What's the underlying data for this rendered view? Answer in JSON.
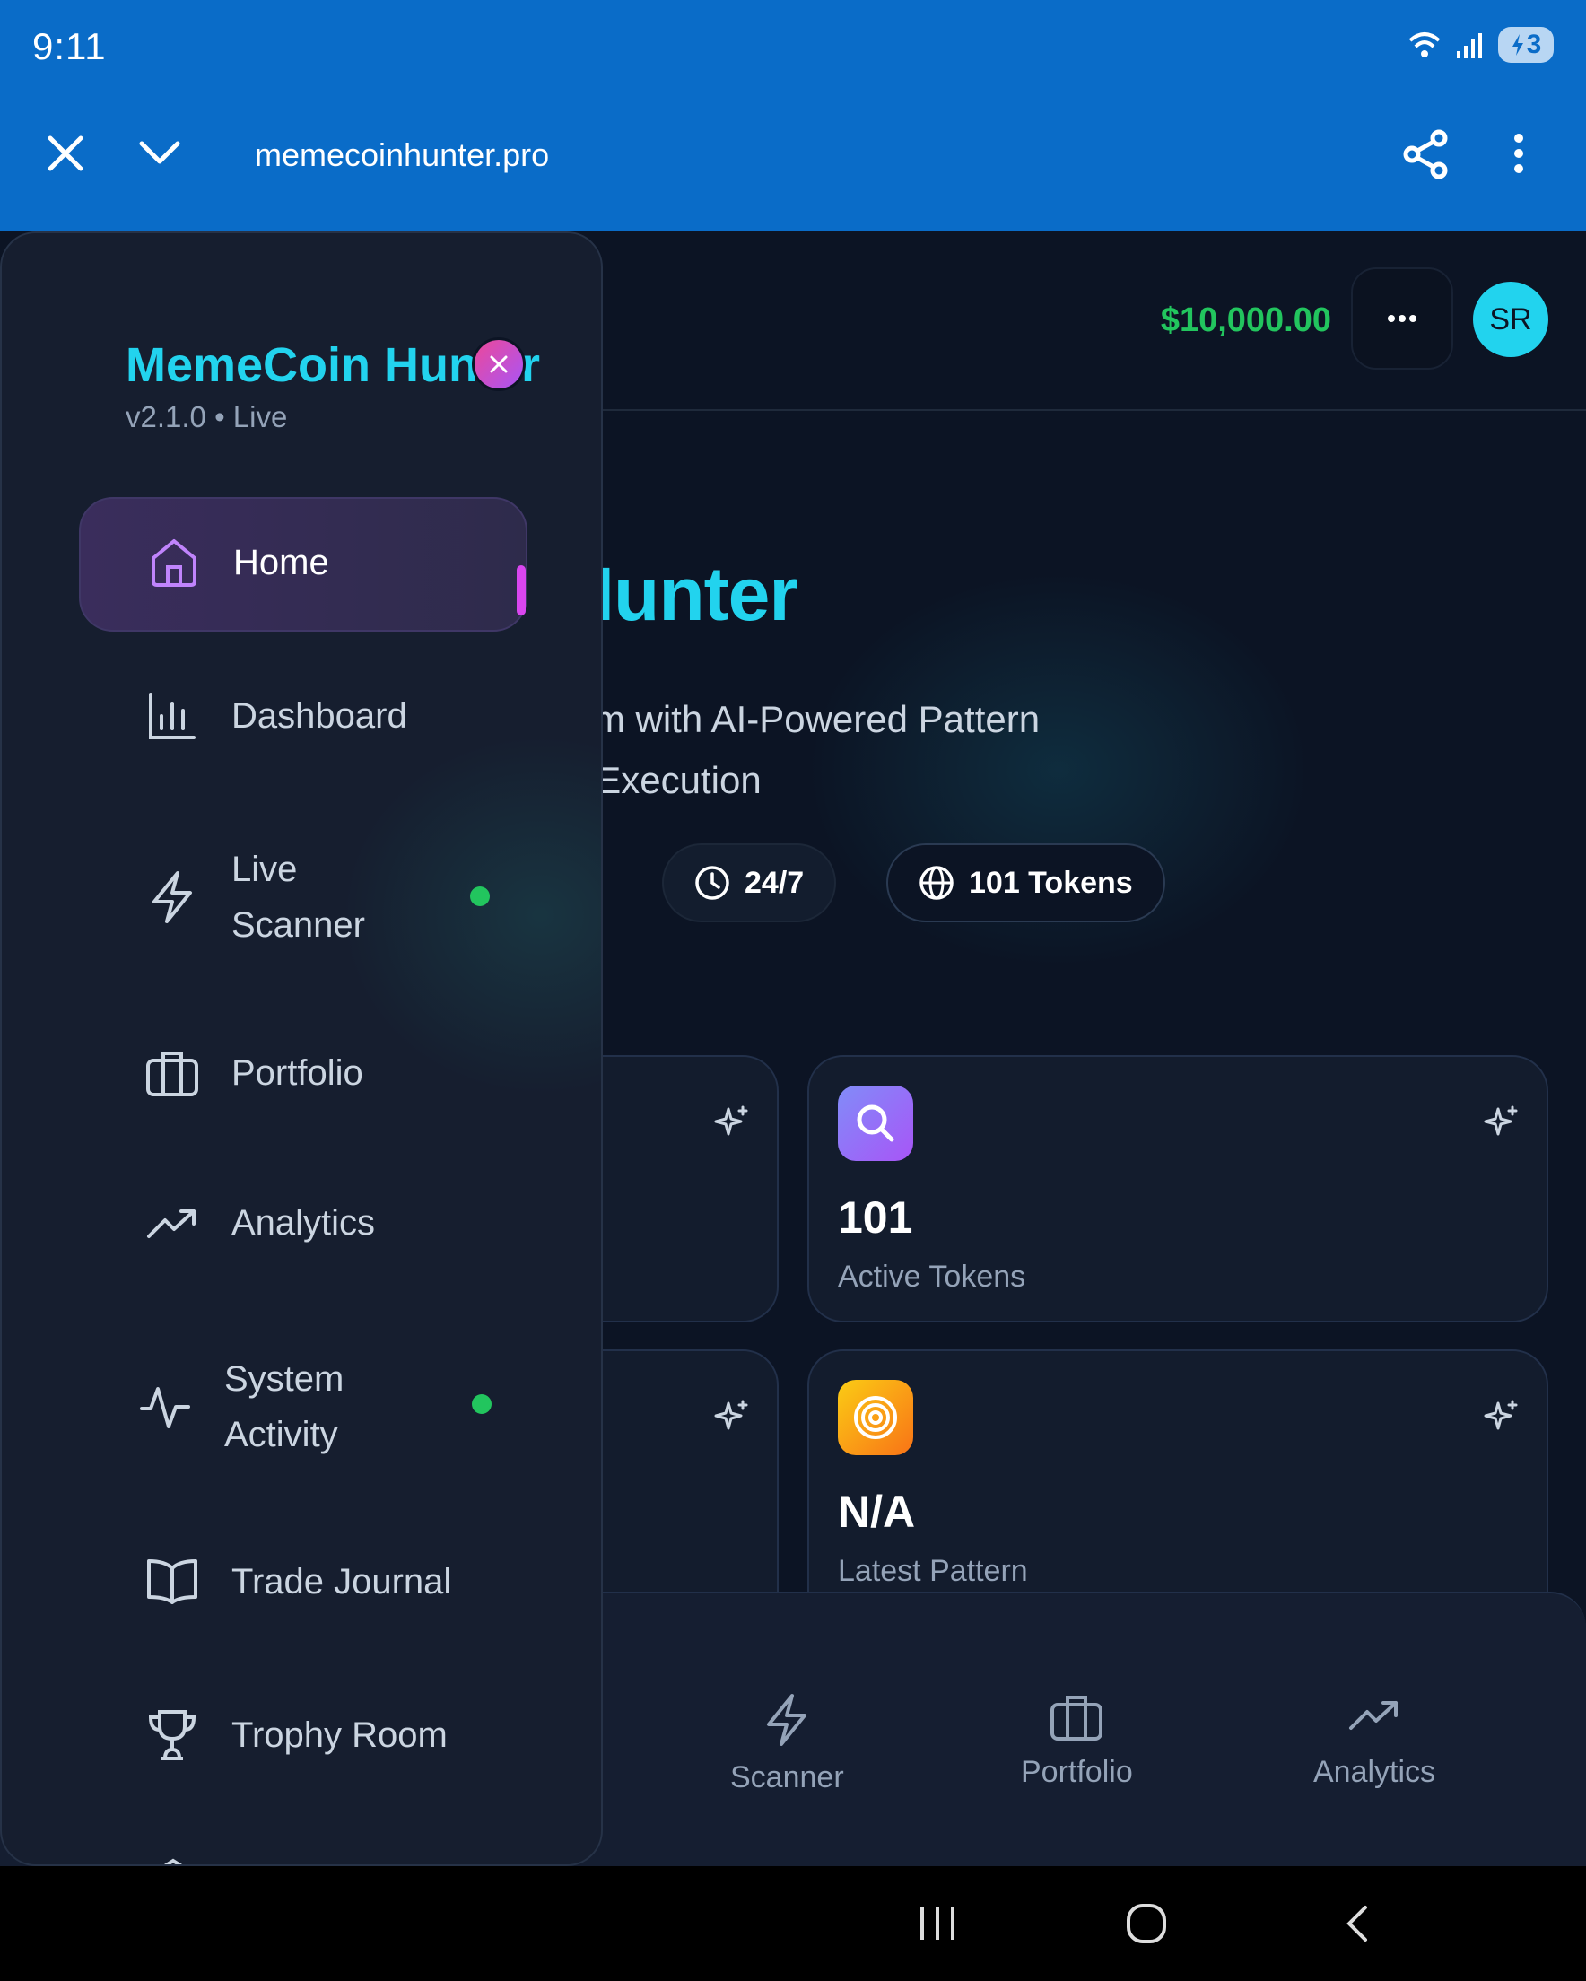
{
  "status_bar": {
    "time": "9:11",
    "battery": "3"
  },
  "browser": {
    "url": "memecoinhunter.pro"
  },
  "header": {
    "balance": "$10,000.00",
    "avatar_initials": "SR"
  },
  "hero": {
    "title": "meCoin Hunter",
    "subtitle_line1": "coin Trading Platform with AI-Powered Pattern",
    "subtitle_line2": "nition & Automated Execution",
    "pills": [
      {
        "icon": "clock-icon",
        "label": "24/7"
      },
      {
        "icon": "globe-icon",
        "label": "101 Tokens"
      }
    ]
  },
  "cards": [
    {
      "value": "101",
      "label": "Active Tokens",
      "icon": "search-icon"
    },
    {
      "value": "N/A",
      "label": "Latest Pattern",
      "icon": "target-icon"
    }
  ],
  "bottom_nav": [
    {
      "label": "Scanner",
      "icon": "bolt-icon"
    },
    {
      "label": "Portfolio",
      "icon": "briefcase-icon"
    },
    {
      "label": "Analytics",
      "icon": "trend-up-icon"
    }
  ],
  "drawer": {
    "brand": "MemeCoin Hunter",
    "version": "v2.1.0 • Live",
    "items": [
      {
        "label": "Home",
        "icon": "home-icon",
        "active": true
      },
      {
        "label": "Dashboard",
        "icon": "bar-chart-icon"
      },
      {
        "label": "Live",
        "label2": "Scanner",
        "icon": "bolt-icon",
        "live": true
      },
      {
        "label": "Portfolio",
        "icon": "briefcase-icon"
      },
      {
        "label": "Analytics",
        "icon": "trend-up-icon"
      },
      {
        "label": "System",
        "label2": "Activity",
        "icon": "activity-icon",
        "live": true
      },
      {
        "label": "Trade Journal",
        "icon": "book-icon"
      },
      {
        "label": "Trophy Room",
        "icon": "trophy-icon"
      }
    ]
  },
  "colors": {
    "accent": "#22d3ee",
    "positive": "#22c55e",
    "active_bar": "#d946ef",
    "background": "#0c1424"
  }
}
